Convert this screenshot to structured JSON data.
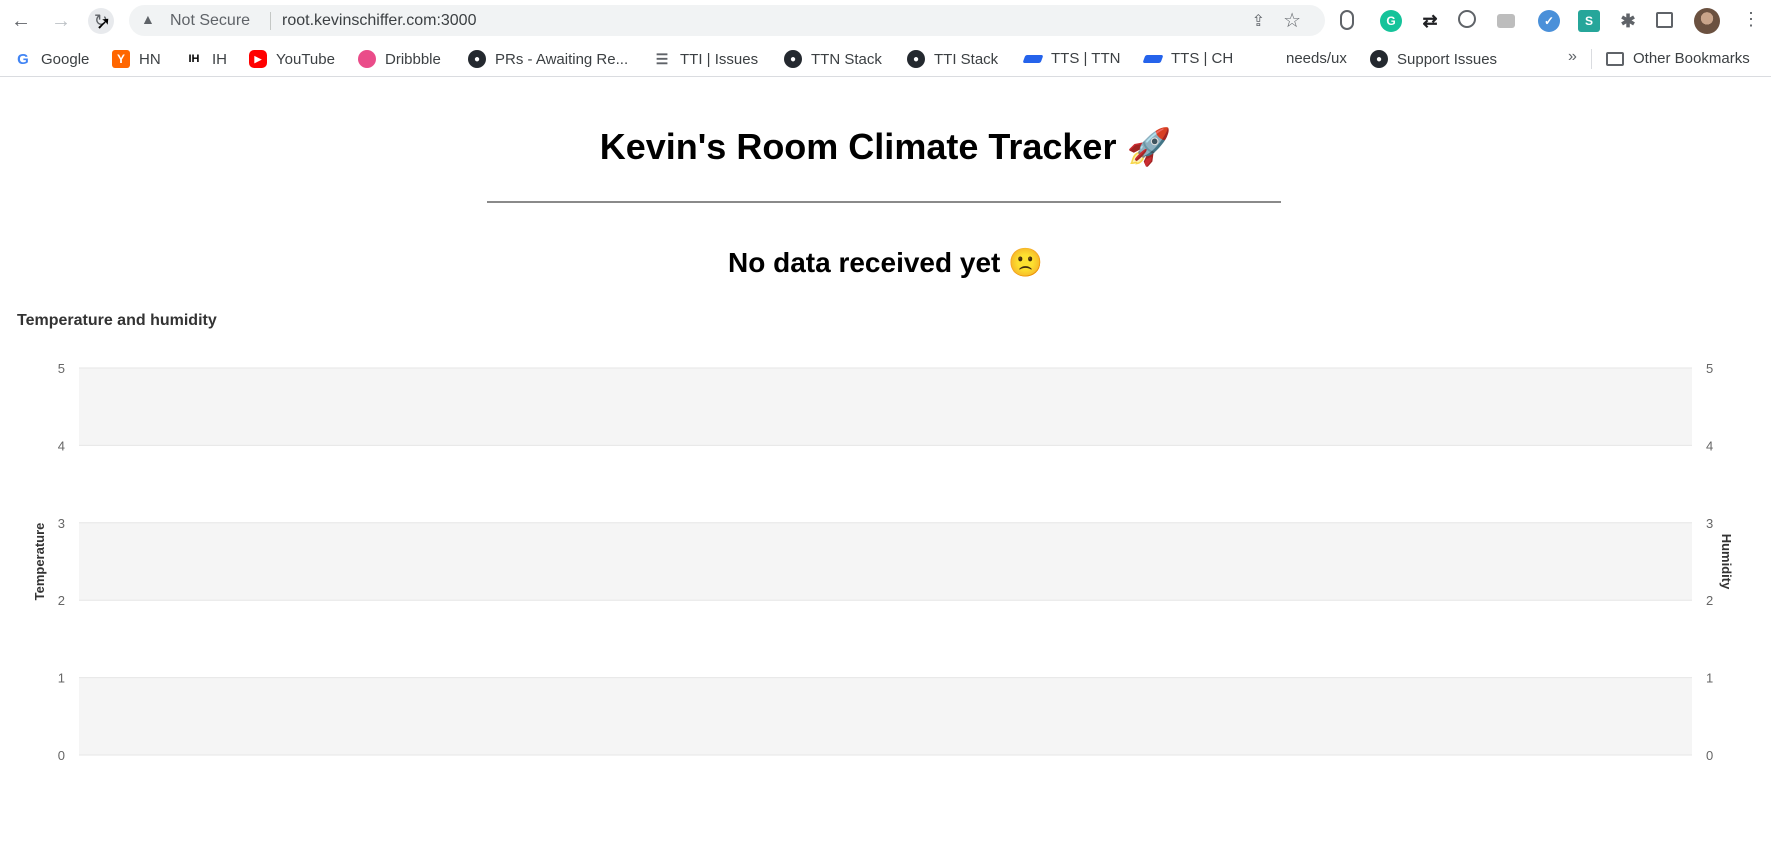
{
  "browser": {
    "not_secure_label": "Not Secure",
    "url": "root.kevinschiffer.com:3000",
    "bookmarks": [
      {
        "label": "Google",
        "icon": "google-icon"
      },
      {
        "label": "HN",
        "icon": "hacker-news-icon"
      },
      {
        "label": "IH",
        "icon": "indie-hackers-icon"
      },
      {
        "label": "YouTube",
        "icon": "youtube-icon"
      },
      {
        "label": "Dribbble",
        "icon": "dribbble-icon"
      },
      {
        "label": "PRs - Awaiting Re...",
        "icon": "github-icon"
      },
      {
        "label": "TTI | Issues",
        "icon": "issues-icon"
      },
      {
        "label": "TTN Stack",
        "icon": "github-icon"
      },
      {
        "label": "TTI Stack",
        "icon": "github-icon"
      },
      {
        "label": "TTS | TTN",
        "icon": "tts-icon"
      },
      {
        "label": "TTS | CH",
        "icon": "tts-icon"
      },
      {
        "label": "needs/ux",
        "icon": ""
      },
      {
        "label": "Support Issues",
        "icon": "github-icon"
      }
    ],
    "more_bookmarks": "»",
    "other_bookmarks": "Other Bookmarks"
  },
  "page": {
    "title": "Kevin's Room Climate Tracker 🚀",
    "status": "No data received yet 🙁"
  },
  "chart_data": {
    "type": "line",
    "title": "Temperature and humidity",
    "ylabel": "Temperature",
    "y2label": "Humidity",
    "ylim": [
      0,
      5
    ],
    "y2lim": [
      0,
      5
    ],
    "yticks": [
      0,
      1,
      2,
      3,
      4,
      5
    ],
    "y2ticks": [
      0,
      1,
      2,
      3,
      4,
      5
    ],
    "series": [],
    "grid": true,
    "alternating_bands": true
  }
}
